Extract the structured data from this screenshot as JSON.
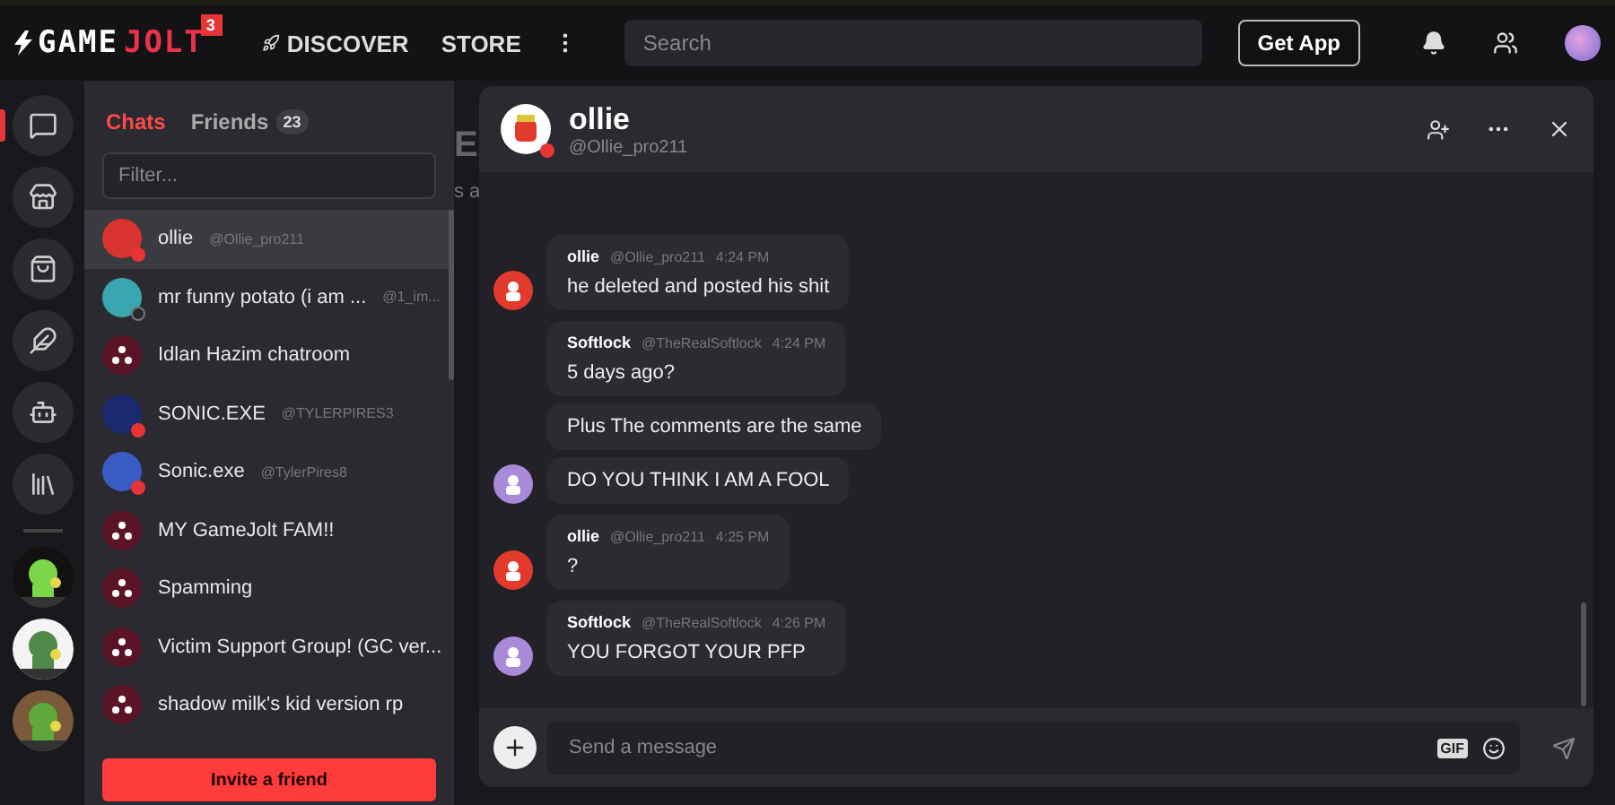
{
  "topbar": {
    "logo": {
      "first": "GAME",
      "second": "JOLT",
      "badge": "3"
    },
    "links": [
      {
        "label": "DISCOVER",
        "icon": true
      },
      {
        "label": "STORE",
        "icon": false
      }
    ],
    "search": {
      "placeholder": "Search"
    },
    "get_app": "Get App"
  },
  "rail": {
    "icons": [
      {
        "kind": "chat",
        "selected": true
      },
      {
        "kind": "store",
        "selected": false
      },
      {
        "kind": "bag",
        "selected": false
      },
      {
        "kind": "quill",
        "selected": false
      },
      {
        "kind": "robot",
        "selected": false
      },
      {
        "kind": "library",
        "selected": false
      }
    ]
  },
  "background_fragments": [
    "E",
    "s a"
  ],
  "friends_panel": {
    "tabs": [
      {
        "label": "Chats",
        "selected": true
      },
      {
        "label": "Friends",
        "count": "23",
        "selected": false
      }
    ],
    "filter": {
      "placeholder": "Filter..."
    },
    "chats": [
      {
        "kind": "user",
        "name": "ollie",
        "handle": "@Ollie_pro211",
        "online": true,
        "selected": true,
        "color": "#d8332f"
      },
      {
        "kind": "user",
        "name": "mr funny potato (i am ...",
        "handle": "@1_im...",
        "online": false,
        "selected": false,
        "color": "#3aa6b0"
      },
      {
        "kind": "group",
        "name": "Idlan Hazim chatroom",
        "selected": false
      },
      {
        "kind": "user",
        "name": "SONIC.EXE",
        "handle": "@TYLERPIRES3",
        "online": true,
        "selected": false,
        "color": "#1b2a6e"
      },
      {
        "kind": "user",
        "name": "Sonic.exe",
        "handle": "@TylerPires8",
        "online": true,
        "selected": false,
        "color": "#3b5bc4"
      },
      {
        "kind": "group",
        "name": "MY GameJolt FAM!!",
        "selected": false
      },
      {
        "kind": "group",
        "name": "Spamming",
        "selected": false
      },
      {
        "kind": "group",
        "name": "Victim Support Group! (GC ver...",
        "selected": false
      },
      {
        "kind": "group",
        "name": "shadow milk's kid version rp",
        "selected": false
      }
    ],
    "invite": "Invite a friend"
  },
  "chat": {
    "name": "ollie",
    "handle": "@Ollie_pro211",
    "online": true,
    "groups": [
      {
        "author": "ollie",
        "handle": "@Ollie_pro211",
        "time": "4:24 PM",
        "color": "#e23b2e",
        "messages": [
          "he deleted and posted his shit"
        ]
      },
      {
        "author": "Softlock",
        "handle": "@TheRealSoftlock",
        "time": "4:24 PM",
        "color": "#a88ad8",
        "messages": [
          "5 days ago?",
          "Plus The comments are the same",
          "DO YOU THINK I AM A FOOL"
        ]
      },
      {
        "author": "ollie",
        "handle": "@Ollie_pro211",
        "time": "4:25 PM",
        "color": "#e23b2e",
        "messages": [
          "?"
        ]
      },
      {
        "author": "Softlock",
        "handle": "@TheRealSoftlock",
        "time": "4:26 PM",
        "color": "#a88ad8",
        "messages": [
          "YOU FORGOT YOUR PFP"
        ]
      }
    ],
    "composer": {
      "placeholder": "Send a message",
      "gif": "GIF"
    }
  }
}
